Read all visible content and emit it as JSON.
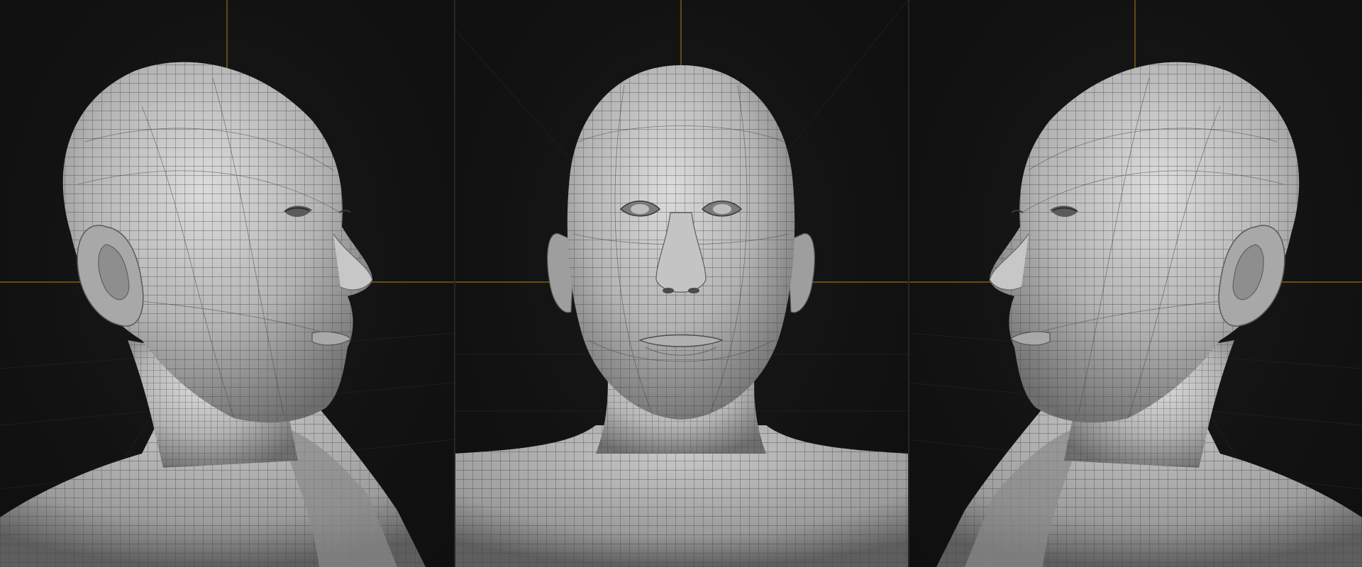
{
  "colors": {
    "background": "#111111",
    "axis_line": "#b0791f",
    "mesh_base": "#9a9a9a",
    "mesh_highlight": "#d8d8d8",
    "wireframe": "#4a4a4a"
  },
  "views": [
    {
      "name": "three-quarter-right",
      "icon": "head-mesh-right-view"
    },
    {
      "name": "front",
      "icon": "head-mesh-front-view"
    },
    {
      "name": "three-quarter-left",
      "icon": "head-mesh-left-view"
    }
  ]
}
